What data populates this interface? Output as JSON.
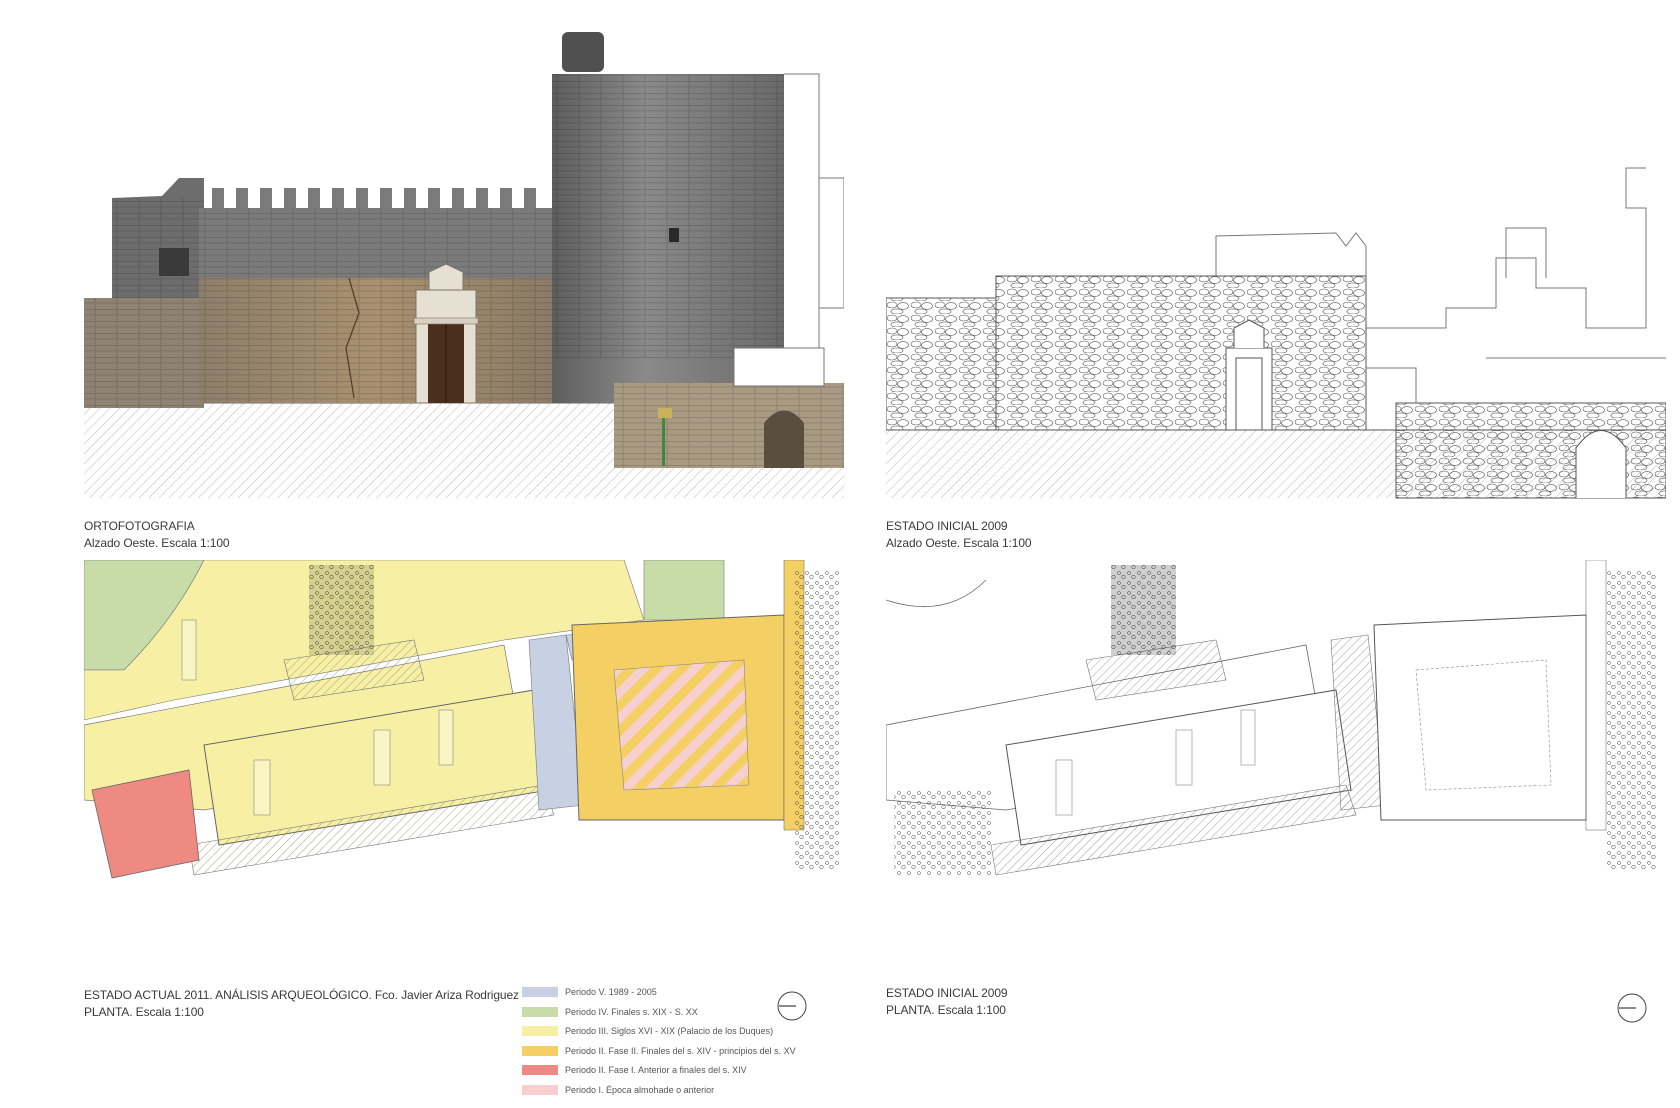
{
  "captions": {
    "ortho": {
      "title": "ORTOFOTOGRAFIA",
      "subtitle": "Alzado Oeste. Escala 1:100"
    },
    "initial_elev": {
      "title": "ESTADO INICIAL 2009",
      "subtitle": "Alzado Oeste. Escala 1:100"
    },
    "actual_plan": {
      "title_main": "ESTADO ACTUAL 2011. ANÁLISIS ARQUEOLÓGICO.",
      "title_author": " Fco. Javier Ariza Rodriguez",
      "subtitle": "PLANTA. Escala 1:100"
    },
    "initial_plan": {
      "title": "ESTADO INICIAL 2009",
      "subtitle": "PLANTA. Escala 1:100"
    }
  },
  "legend": [
    {
      "label": "Periodo V. 1989 - 2005",
      "color": "#c7d1e3"
    },
    {
      "label": "Periodo IV. Finales s. XIX - S. XX",
      "color": "#c8dca9"
    },
    {
      "label": "Periodo III. Siglos XVI - XIX (Palacio de los Duques)",
      "color": "#f7f0a4"
    },
    {
      "label": "Periodo II. Fase II. Finales del s. XIV - principios del s. XV",
      "color": "#f4cf63"
    },
    {
      "label": "Periodo II. Fase I. Anterior a finales del s. XIV",
      "color": "#ef8a82"
    },
    {
      "label": "Periodo I. Época almohade o anterior",
      "color": "#f7cfcf"
    }
  ],
  "colors": {
    "stone_warm": "#9c8a73",
    "tower_grey": "#7a7a7a",
    "door_brown": "#4a2e1e",
    "line": "#555555"
  },
  "icons": {
    "north_arrow": "north-arrow-icon"
  }
}
